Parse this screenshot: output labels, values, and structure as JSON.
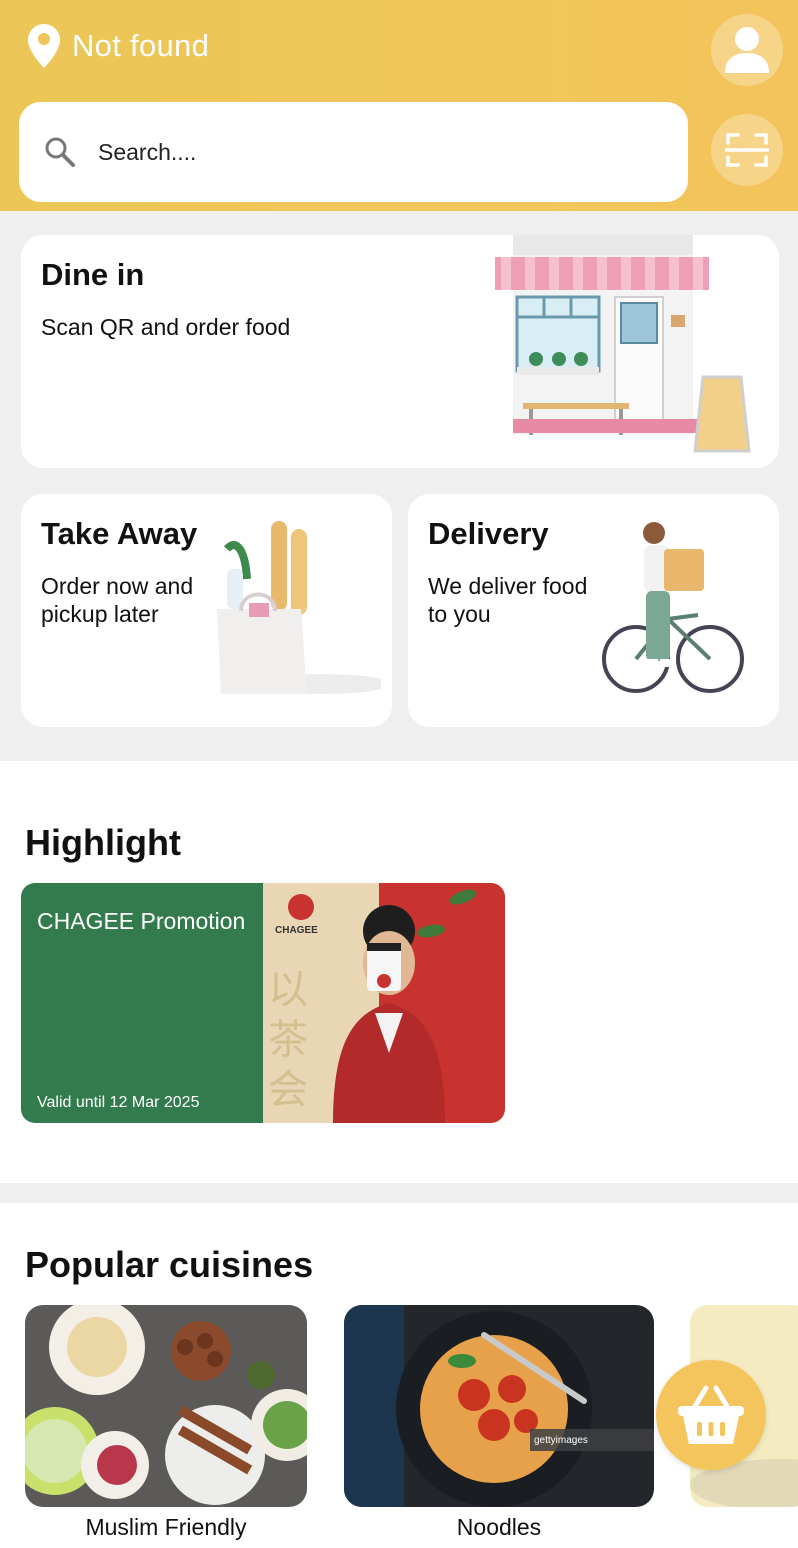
{
  "header": {
    "location_text": "Not found",
    "search_placeholder": "Search...."
  },
  "services": {
    "dine_in": {
      "title": "Dine in",
      "subtitle": "Scan QR and order food"
    },
    "take_away": {
      "title": "Take Away",
      "subtitle": "Order now and pickup later"
    },
    "delivery": {
      "title": "Delivery",
      "subtitle": "We deliver food to you"
    }
  },
  "highlight": {
    "title": "Highlight",
    "promo": {
      "name": "CHAGEE Promotion",
      "valid": "Valid until 12 Mar 2025",
      "brand": "CHAGEE"
    }
  },
  "popular": {
    "title": "Popular cuisines",
    "items": [
      {
        "label": "Muslim Friendly"
      },
      {
        "label": "Noodles"
      }
    ]
  },
  "colors": {
    "header_yellow": "#f0c65a",
    "promo_green": "#337a4c",
    "cart_yellow": "#f4c55c",
    "section_gray": "#efefef"
  },
  "icons": [
    "location-pin-icon",
    "profile-icon",
    "search-icon",
    "qr-scan-icon",
    "shopping-basket-icon"
  ]
}
